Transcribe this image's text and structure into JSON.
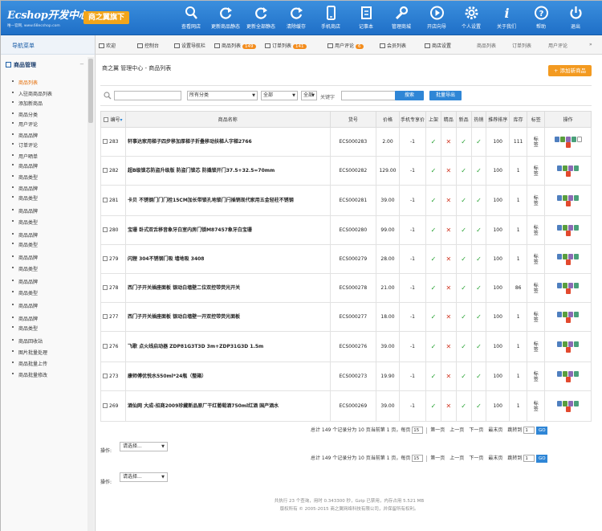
{
  "header": {
    "logo": "Ecshop开发中心",
    "logo_sub": "唯一官网, www.68ecshop.com",
    "brand": "商之翼旗下",
    "tools": [
      {
        "label": "查看网店",
        "icon": "search-icon"
      },
      {
        "label": "更新商品静态",
        "icon": "refresh-icon"
      },
      {
        "label": "更新全部静态",
        "icon": "refresh-icon"
      },
      {
        "label": "清除缓存",
        "icon": "refresh-icon"
      },
      {
        "label": "手机商店",
        "icon": "phone-icon"
      },
      {
        "label": "记事本",
        "icon": "notepad-icon"
      },
      {
        "label": "管理商城",
        "icon": "wrench-icon"
      },
      {
        "label": "开店向导",
        "icon": "play-icon"
      },
      {
        "label": "个人设置",
        "icon": "gear-icon"
      },
      {
        "label": "关于我们",
        "icon": "info-icon"
      },
      {
        "label": "帮助",
        "icon": "help-icon"
      },
      {
        "label": "退出",
        "icon": "power-icon"
      }
    ]
  },
  "sidebar": {
    "title": "导航菜单",
    "section": "商品管理",
    "collapse": "−",
    "items": [
      "商品列表",
      "入驻商商品列表",
      "添加新商品",
      "商品分类",
      "用户评论",
      "商品品牌",
      "订单评论",
      "用户晒单",
      "商品品牌",
      "商品类型",
      "商品品牌",
      "商品类型",
      "商品品牌",
      "商品类型",
      "商品品牌",
      "商品类型",
      "商品品牌",
      "商品类型",
      "商品品牌",
      "商品类型",
      "商品品牌",
      "商品品牌",
      "商品类型",
      "商品回收站",
      "图片批量处理",
      "商品批量上传",
      "商品批量修改"
    ]
  },
  "tabbar": {
    "tabs": [
      {
        "label": "欢迎"
      },
      {
        "label": "控制台"
      },
      {
        "label": "设置导航栏"
      },
      {
        "label": "商品列表",
        "badge": "149"
      },
      {
        "label": "订单列表",
        "badge": "141"
      },
      {
        "label": "用户评论",
        "badge": "6"
      },
      {
        "label": "会员列表"
      },
      {
        "label": "商店设置"
      }
    ],
    "right_tabs": [
      "商品列表",
      "订单列表",
      "用户评论"
    ],
    "more": "»"
  },
  "page": {
    "breadcrumb": "商之翼 管理中心 - 商品列表",
    "add_button": "+ 添加新商品"
  },
  "search": {
    "category": "所有分类",
    "brand": "全部",
    "status": "全部",
    "keyword_label": "关键字",
    "search_button": "搜索",
    "export_button": "批量导出"
  },
  "table": {
    "headers": [
      "编号",
      "商品名称",
      "货号",
      "价格",
      "手机专享价",
      "上架",
      "精品",
      "新品",
      "热销",
      "推荐排序",
      "库存",
      "标签",
      "操作"
    ],
    "rows": [
      {
        "id": "283",
        "name": "轩事达家用梯子四步移加厚梯子折叠移动扶梯人字梯2766",
        "sn": "ECS000283",
        "price": "2.00",
        "mobile": "-1",
        "onsale": true,
        "best": false,
        "new": true,
        "hot": true,
        "sort": "100",
        "stock": "111",
        "tag": "标签"
      },
      {
        "id": "282",
        "name": "超B级锁芯防盗升级版 防盗门锁芯 防撬锁开门37.5+32.5=70mm",
        "sn": "ECS000282",
        "price": "129.00",
        "mobile": "-1",
        "onsale": true,
        "best": false,
        "new": true,
        "hot": true,
        "sort": "100",
        "stock": "1",
        "tag": "标签"
      },
      {
        "id": "281",
        "name": "卡贝 不锈钢门门门栓15CM加长带锁孔地锁门闩插销现代家用五金轻柱不锈钢",
        "sn": "ECS000281",
        "price": "39.00",
        "mobile": "-1",
        "onsale": true,
        "best": false,
        "new": true,
        "hot": true,
        "sort": "100",
        "stock": "1",
        "tag": "标签"
      },
      {
        "id": "280",
        "name": "宝珊 卧式双舌移音象牙白室内房门锁M87457象牙白宝珊",
        "sn": "ECS000280",
        "price": "99.00",
        "mobile": "-1",
        "onsale": true,
        "best": false,
        "new": true,
        "hot": true,
        "sort": "100",
        "stock": "1",
        "tag": "标签"
      },
      {
        "id": "279",
        "name": "闪狸 304不锈钢门吸 墙地吸 3408",
        "sn": "ECS000279",
        "price": "28.00",
        "mobile": "-1",
        "onsale": true,
        "best": false,
        "new": true,
        "hot": true,
        "sort": "100",
        "stock": "1",
        "tag": "标签"
      },
      {
        "id": "278",
        "name": "西门子开关插座面板 银动白墙壁二位双控带荧光开关",
        "sn": "ECS000278",
        "price": "21.00",
        "mobile": "-1",
        "onsale": true,
        "best": false,
        "new": true,
        "hot": true,
        "sort": "100",
        "stock": "86",
        "tag": "标签"
      },
      {
        "id": "277",
        "name": "西门子开关插座面板 银动白墙壁一开双控带荧光面板",
        "sn": "ECS000277",
        "price": "18.00",
        "mobile": "-1",
        "onsale": true,
        "best": false,
        "new": true,
        "hot": true,
        "sort": "100",
        "stock": "1",
        "tag": "标签"
      },
      {
        "id": "276",
        "name": "飞歌 点火线启动器 ZDP81G3T3D 3m+ZDP31G3D 1.5m",
        "sn": "ECS000276",
        "price": "39.00",
        "mobile": "-1",
        "onsale": true,
        "best": false,
        "new": true,
        "hot": true,
        "sort": "100",
        "stock": "1",
        "tag": "标签"
      },
      {
        "id": "273",
        "name": "康师傅优悦水550ml*24瓶（整箱）",
        "sn": "ECS000273",
        "price": "19.90",
        "mobile": "-1",
        "onsale": true,
        "best": false,
        "new": true,
        "hot": true,
        "sort": "100",
        "stock": "1",
        "tag": "标签"
      },
      {
        "id": "269",
        "name": "酒仙网 大成-招商2009珍藏新品原厂干红葡萄酒750ml红酒 国产酒水",
        "sn": "ECS000269",
        "price": "39.00",
        "mobile": "-1",
        "onsale": true,
        "best": false,
        "new": true,
        "hot": true,
        "sort": "100",
        "stock": "1",
        "tag": "标签"
      }
    ]
  },
  "pager": {
    "summary": "总计 149 个记录分为 10 页当前第 1 页，每页",
    "per_page": "15",
    "first": "第一页",
    "prev": "上一页",
    "next": "下一页",
    "last": "最末页",
    "jump_label": "跳转到",
    "jump_value": "1",
    "go": "GO"
  },
  "batch": {
    "label": "操作:",
    "select": "请选择..."
  },
  "footer": {
    "line1": "共执行 23 个查询，用时 0.343300 秒，Gzip 已禁用，内存占用 5.521 MB",
    "line2": "版权所有 © 2005-2015 商之翼网络科技有限公司，并保留所有权利。"
  },
  "colors": {
    "header": "#2b7fd4",
    "accent": "#f39a20",
    "check": "#23a02f",
    "cross": "#d23c28"
  }
}
